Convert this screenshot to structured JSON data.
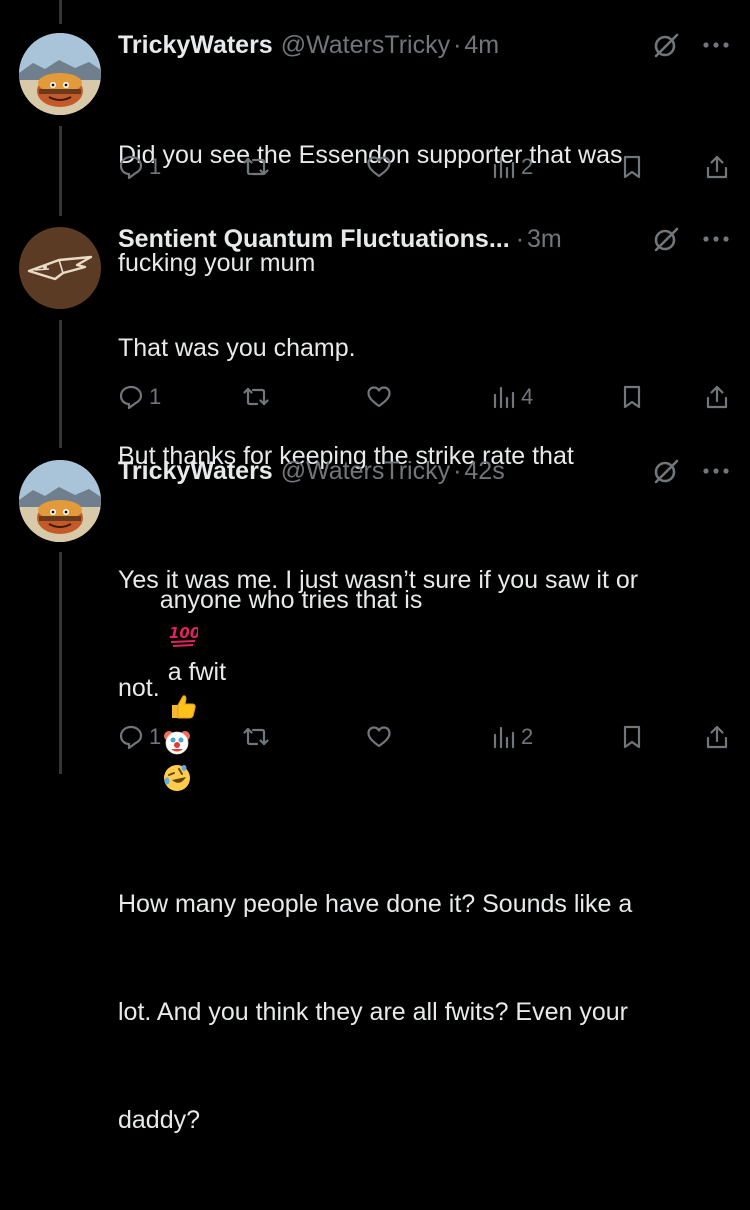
{
  "colors": {
    "background": "#000000",
    "text": "#e7e9ea",
    "muted": "#71767b",
    "thread_line": "#333639"
  },
  "tweets": [
    {
      "name": "TrickyWaters",
      "handle": "@WatersTricky",
      "time": "4m",
      "avatar_icon": "burger-character-avatar",
      "text_lines": [
        "Did you see the Essendon supporter that was",
        "fucking your mum"
      ],
      "replies": "1",
      "retweets": "",
      "likes": "",
      "views": "2"
    },
    {
      "name": "Sentient Quantum Fluctuations...",
      "handle": "",
      "time": "3m",
      "avatar_icon": "bird-logo-avatar",
      "text_lines": [
        "That was you champ.",
        "But thanks for keeping the strike rate that",
        "anyone who tries that is"
      ],
      "text_tail": "a fwit",
      "emojis": [
        "hundred-points-emoji",
        "thumbs-up-emoji",
        "clown-face-emoji",
        "rofl-emoji"
      ],
      "replies": "1",
      "retweets": "",
      "likes": "",
      "views": "4"
    },
    {
      "name": "TrickyWaters",
      "handle": "@WatersTricky",
      "time": "42s",
      "avatar_icon": "burger-character-avatar",
      "text_lines": [
        "Yes it was me. I just wasn’t sure if you saw it or",
        "not.",
        "",
        "How many people have done it? Sounds like a",
        "lot. And you think they are all fwits? Even your",
        "daddy?"
      ],
      "replies": "1",
      "retweets": "",
      "likes": "",
      "views": "2"
    }
  ],
  "separator": "·"
}
